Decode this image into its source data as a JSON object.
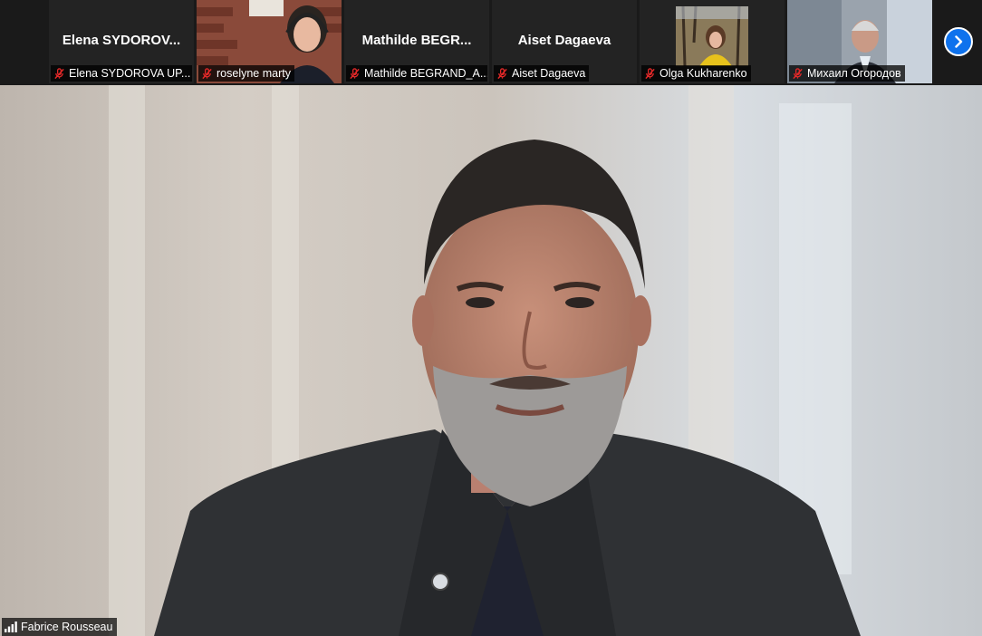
{
  "participants": [
    {
      "display_name": "Elena  SYDOROV...",
      "label": "Elena SYDOROVA UP..."
    },
    {
      "display_name": "",
      "label": "roselyne marty"
    },
    {
      "display_name": "Mathilde  BEGR...",
      "label": "Mathilde BEGRAND_A..."
    },
    {
      "display_name": "Aiset Dagaeva",
      "label": "Aiset Dagaeva"
    },
    {
      "display_name": "",
      "label": "Olga Kukharenko"
    },
    {
      "display_name": "",
      "label": "Михаил Огородов"
    }
  ],
  "active_speaker": {
    "name": "Fabrice Rousseau"
  },
  "icons": {
    "mute": "mic-muted-icon",
    "signal": "signal-bars-icon",
    "next": "chevron-right-icon"
  },
  "colors": {
    "accent": "#0e72ed",
    "mute": "#e02828",
    "strip_bg": "#1a1a1a"
  }
}
